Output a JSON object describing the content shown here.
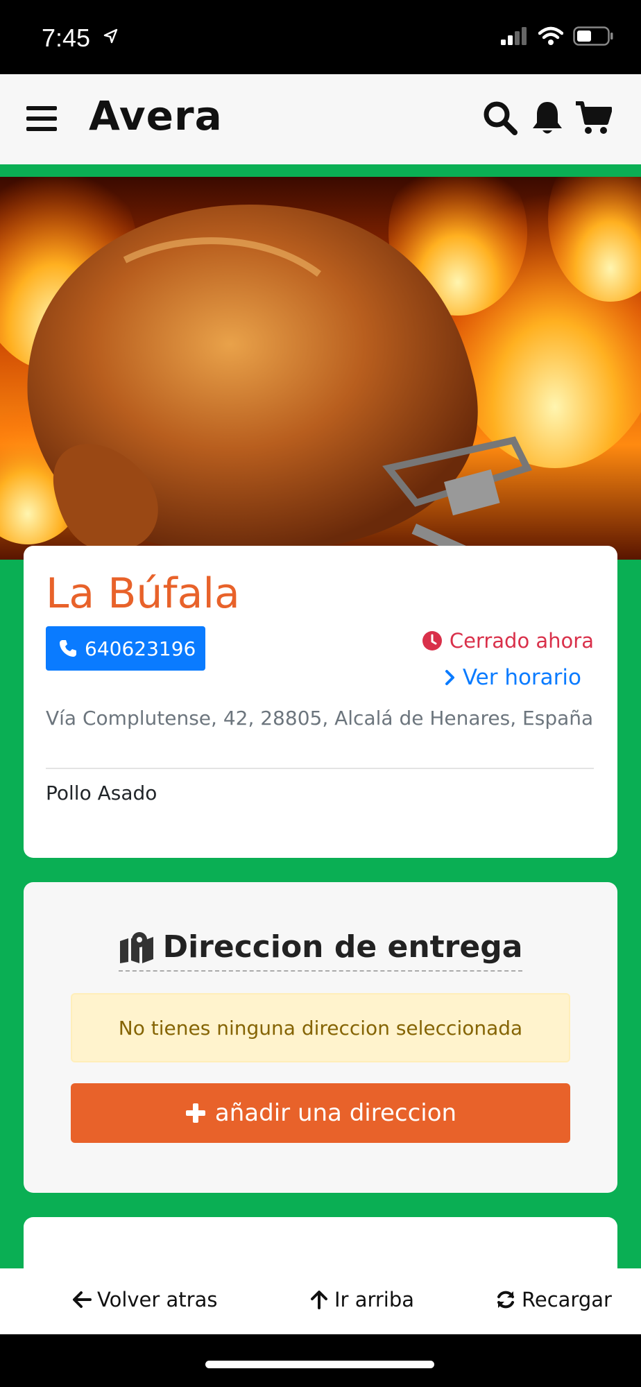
{
  "status_bar": {
    "time": "7:45"
  },
  "header": {
    "brand": "Avera",
    "icons": [
      "menu-icon",
      "search-icon",
      "bell-icon",
      "cart-icon"
    ]
  },
  "restaurant": {
    "name": "La Búfala",
    "phone": "640623196",
    "status": "Cerrado ahora",
    "schedule_link": "Ver horario",
    "address": "Vía Complutense, 42, 28805, Alcalá de Henares, España",
    "category": "Pollo Asado"
  },
  "delivery": {
    "title": "Direccion de entrega",
    "alert": "No tienes ninguna direccion seleccionada",
    "add_button": "añadir una direccion"
  },
  "bottom_nav": {
    "back": "Volver atras",
    "top": "Ir arriba",
    "reload": "Recargar"
  },
  "colors": {
    "brand_green": "#0aaf54",
    "accent_orange": "#e8622a",
    "link_blue": "#0a7bff",
    "closed_red": "#d9304a",
    "alert_bg": "#fff3cd",
    "alert_text": "#856404"
  }
}
